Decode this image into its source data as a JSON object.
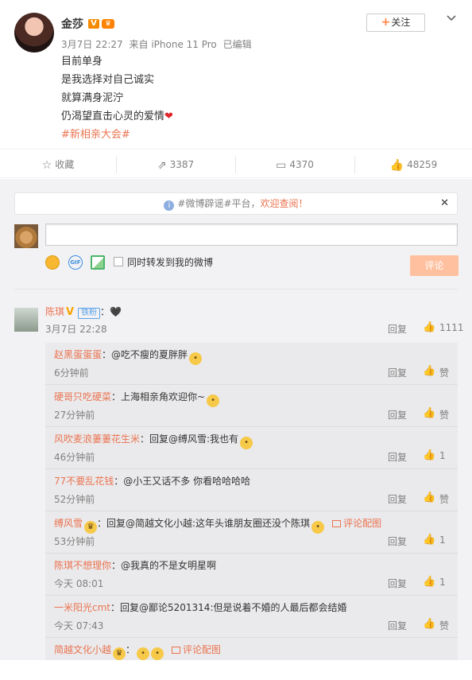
{
  "post": {
    "author": "金莎",
    "time": "3月7日 22:27",
    "source": "来自 iPhone 11 Pro",
    "edited": "已编辑",
    "follow_label": "关注",
    "lines": [
      "目前单身",
      "是我选择对自己诚实",
      "就算满身泥泞",
      "仍渴望直击心灵的爱情"
    ],
    "hashtag": "#新相亲大会#"
  },
  "actions": {
    "favorite": "收藏",
    "repost": "3387",
    "comment": "4370",
    "like": "48259"
  },
  "notice": {
    "text": "#微博辟谣#平台，",
    "link": "欢迎查阅！"
  },
  "composer": {
    "repost_label": "同时转发到我的微博",
    "submit": "评论"
  },
  "top_comment": {
    "user": "陈琪",
    "fan_badge": "铁粉",
    "text": "：🖤",
    "time": "3月7日 22:28",
    "reply": "回复",
    "likes": "1111"
  },
  "replies": [
    {
      "user": "赵黑蛋蛋蛋",
      "body": "：@吃不瘦的夏胖胖",
      "time": "6分钟前",
      "reply": "回复",
      "likes": "赞"
    },
    {
      "user": "硬哥只吃硬菜",
      "body": "：上海相亲角欢迎你~",
      "time": "27分钟前",
      "reply": "回复",
      "likes": "赞"
    },
    {
      "user": "风吹麦浪萋萋花生米",
      "body": "：回复@缚风雪:我也有",
      "time": "46分钟前",
      "reply": "回复",
      "likes": "1"
    },
    {
      "user": "77不要乱花钱",
      "body": "：@小王又话不多 你看哈哈哈哈",
      "time": "52分钟前",
      "reply": "回复",
      "likes": "赞"
    },
    {
      "user": "缚风雪",
      "body": "：回复@简越文化小越:这年头谁朋友圈还没个陈琪",
      "pic": "评论配图",
      "time": "53分钟前",
      "reply": "回复",
      "likes": "1"
    },
    {
      "user": "陈琪不想理你",
      "body": "：@我真的不是女明星啊",
      "time": "今天 08:01",
      "reply": "回复",
      "likes": "1"
    },
    {
      "user": "一米阳光cmt",
      "body": "：回复@鄙论5201314:但是说着不婚的人最后都会结婚",
      "time": "今天 07:43",
      "reply": "回复",
      "likes": "赞"
    },
    {
      "user": "简越文化小越",
      "body": "：",
      "pic": "评论配图",
      "time": "",
      "reply": "",
      "likes": ""
    }
  ]
}
